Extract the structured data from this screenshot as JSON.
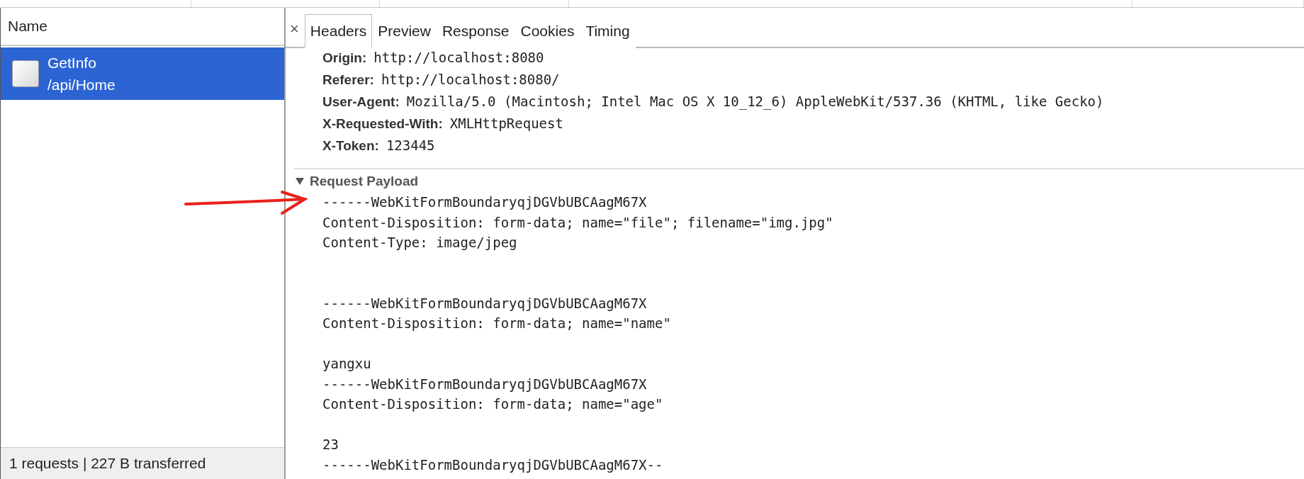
{
  "name_column": {
    "title": "Name"
  },
  "requests": [
    {
      "name": "GetInfo",
      "path": "/api/Home",
      "selected": true
    }
  ],
  "status_bar": "1 requests | 227 B transferred",
  "close": "×",
  "tabs": [
    {
      "label": "Headers",
      "selected": true
    },
    {
      "label": "Preview",
      "selected": false
    },
    {
      "label": "Response",
      "selected": false
    },
    {
      "label": "Cookies",
      "selected": false
    },
    {
      "label": "Timing",
      "selected": false
    }
  ],
  "headers": [
    {
      "key": "Origin:",
      "value": "http://localhost:8080"
    },
    {
      "key": "Referer:",
      "value": "http://localhost:8080/"
    },
    {
      "key": "User-Agent:",
      "value": "Mozilla/5.0 (Macintosh; Intel Mac OS X 10_12_6) AppleWebKit/537.36 (KHTML, like Gecko)"
    },
    {
      "key": "X-Requested-With:",
      "value": "XMLHttpRequest"
    },
    {
      "key": "X-Token:",
      "value": "123445"
    }
  ],
  "payload": {
    "title": "Request Payload",
    "expanded": true,
    "text": "------WebKitFormBoundaryqjDGVbUBCAagM67X\nContent-Disposition: form-data; name=\"file\"; filename=\"img.jpg\"\nContent-Type: image/jpeg\n\n\n------WebKitFormBoundaryqjDGVbUBCAagM67X\nContent-Disposition: form-data; name=\"name\"\n\nyangxu\n------WebKitFormBoundaryqjDGVbUBCAagM67X\nContent-Disposition: form-data; name=\"age\"\n\n23\n------WebKitFormBoundaryqjDGVbUBCAagM67X--"
  }
}
